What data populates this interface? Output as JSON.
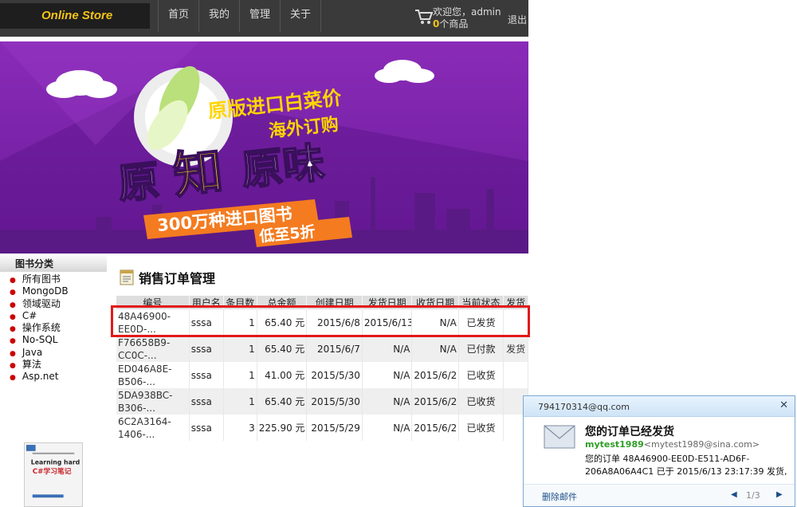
{
  "header": {
    "logo": "Online Store",
    "nav": [
      "首页",
      "我的",
      "管理",
      "关于"
    ],
    "welcome": "欢迎您，admin",
    "cart_count": "0",
    "cart_suffix": "个商品",
    "logout": "退出"
  },
  "banner": {
    "line1": "原版进口白菜价",
    "line2": "海外订购",
    "big_left": "原",
    "big_mid": "知",
    "big_right": "原味",
    "ribbon1": "300万种进口图书",
    "ribbon2": "低至5折"
  },
  "sidebar": {
    "title": "图书分类",
    "categories": [
      "所有图书",
      "MongoDB",
      "领域驱动",
      "C#",
      "操作系统",
      "No-SQL",
      "Java",
      "算法",
      "Asp.net"
    ],
    "book_line1": "Learning hard",
    "book_line2": "C#学习笔记"
  },
  "main": {
    "title": "销售订单管理",
    "columns": [
      "编号",
      "用户名",
      "条目数",
      "总金额",
      "创建日期",
      "发货日期",
      "收货日期",
      "当前状态",
      "发货"
    ],
    "rows": [
      {
        "id1": "48A46900-",
        "id2": "EE0D-...",
        "user": "sssa",
        "count": "1",
        "total": "65.40 元",
        "created": "2015/6/8",
        "shipped": "2015/6/13",
        "received": "N/A",
        "status": "已发货",
        "action": ""
      },
      {
        "id1": "F76658B9-",
        "id2": "CC0C-...",
        "user": "sssa",
        "count": "1",
        "total": "65.40 元",
        "created": "2015/6/7",
        "shipped": "N/A",
        "received": "N/A",
        "status": "已付款",
        "action": "发货"
      },
      {
        "id1": "ED046A8E-",
        "id2": "B506-...",
        "user": "sssa",
        "count": "1",
        "total": "41.00 元",
        "created": "2015/5/30",
        "shipped": "N/A",
        "received": "2015/6/2",
        "status": "已收货",
        "action": ""
      },
      {
        "id1": "5DA938BC-",
        "id2": "B306-...",
        "user": "sssa",
        "count": "1",
        "total": "65.40 元",
        "created": "2015/5/30",
        "shipped": "N/A",
        "received": "2015/6/2",
        "status": "已收货",
        "action": ""
      },
      {
        "id1": "6C2A3164-",
        "id2": "1406-...",
        "user": "sssa",
        "count": "3",
        "total": "225.90 元",
        "created": "2015/5/29",
        "shipped": "N/A",
        "received": "2015/6/2",
        "status": "已收货",
        "action": ""
      }
    ]
  },
  "notification": {
    "account": "794170314@qq.com",
    "subject": "您的订单已经发货",
    "sender_name": "mytest1989",
    "sender_addr": "<mytest1989@sina.com>",
    "body_line1": "您的订单 48A46900-EE0D-E511-AD6F-",
    "body_line2": "206A8A06A4C1 已于 2015/6/13 23:17:39 发货, ...",
    "delete": "删除邮件",
    "page": "1/3"
  },
  "colors": {
    "topbar": "#3a3a3a",
    "logo_text": "#f3c316",
    "banner_purple": "#7b1fa2",
    "highlight_border": "#e21919",
    "sender_green": "#2f9d27"
  }
}
